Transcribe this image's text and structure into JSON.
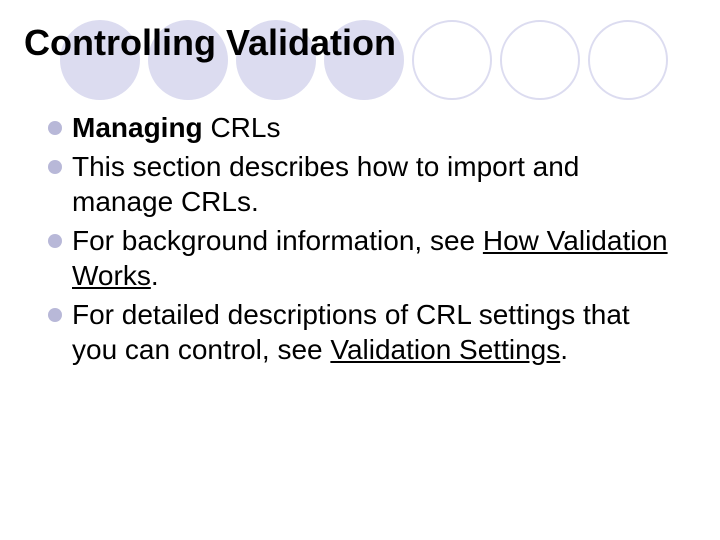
{
  "title": "Controlling Validation",
  "bullets": {
    "b0_lead": "Managing",
    "b0_rest": " CRLs",
    "b1": "This section describes how to import and manage CRLs.",
    "b2_pre": "For background information, see ",
    "b2_link": "How Validation Works",
    "b2_post": ".",
    "b3_pre": "For detailed descriptions of CRL settings that you can control, see ",
    "b3_link": "Validation Settings",
    "b3_post": "."
  }
}
